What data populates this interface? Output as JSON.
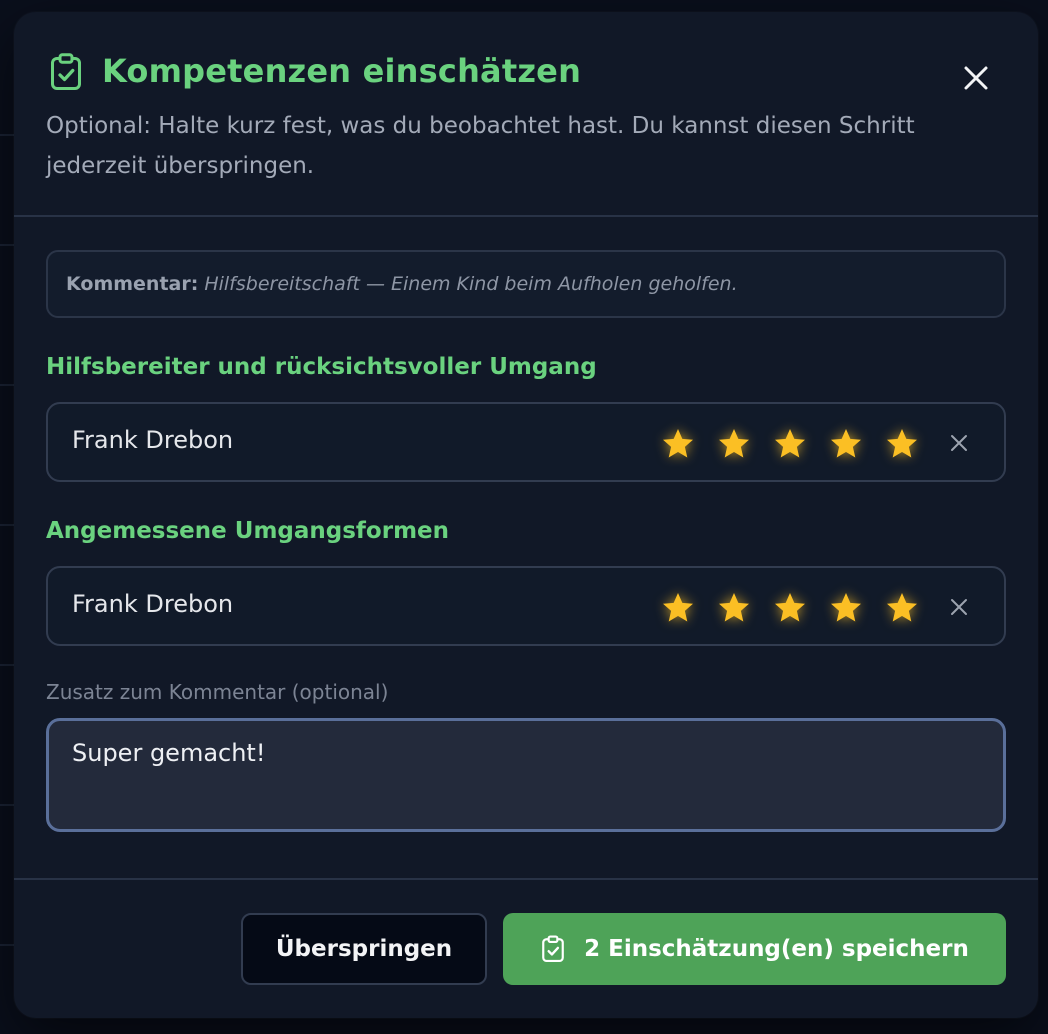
{
  "dialog": {
    "title": "Kompetenzen einschätzen",
    "subtitle": "Optional: Halte kurz fest, was du beobachtet hast. Du kannst diesen Schritt jederzeit überspringen."
  },
  "comment": {
    "label": "Kommentar:",
    "text": "Hilfsbereitschaft — Einem Kind beim Aufholen geholfen."
  },
  "competencies": [
    {
      "title": "Hilfsbereiter und rücksichtsvoller Umgang",
      "person": "Frank Drebon",
      "rating": 5,
      "max": 5
    },
    {
      "title": "Angemessene Umgangsformen",
      "person": "Frank Drebon",
      "rating": 5,
      "max": 5
    }
  ],
  "addition": {
    "label": "Zusatz zum Kommentar (optional)",
    "value": "Super gemacht!"
  },
  "buttons": {
    "skip": "Überspringen",
    "save": "2 Einschätzung(en) speichern"
  },
  "colors": {
    "accent": "#6ad27f",
    "star": "#fbbf24",
    "save_bg": "#4ea358",
    "modal_bg": "#111827"
  },
  "icons": {
    "title": "clipboard-check-icon",
    "close": "close-icon",
    "star": "star-icon",
    "remove": "x-icon"
  }
}
